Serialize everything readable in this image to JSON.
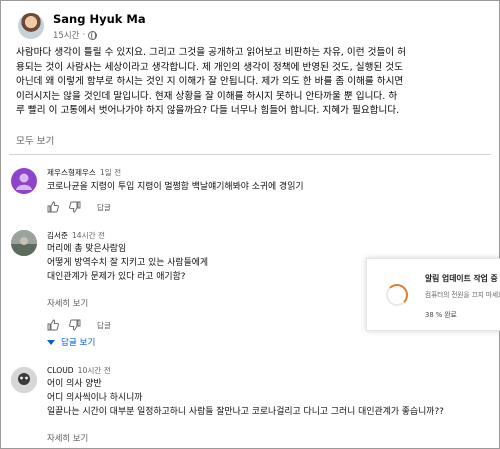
{
  "post": {
    "author": "Sang Hyuk Ma",
    "time": "15시간",
    "audience_icon": "globe-icon",
    "body_lines": [
      "사람마다 생각이 틀릴 수 있지요. 그리고 그것을 공개하고 읽어보고 비판하는 자유, 이런 것들이 허",
      "용되는 것이 사람사는 세상이라고 생각합니다. 제 개인의 생각이 정책에 반영된 것도, 실행된 것도",
      "아닌데 왜 이렇게 함부로 하시는 것인 지 이해가 잘 안됩니다. 제가 의도 한 바를 좀 이해를 하시면",
      "이러시지는 않을 것인데 말입니다. 현재 상황을 잘 이해를 하시지 못하니 안타까울 뿐 입니다. 하",
      "루 빨리 이 고통에서 벗어나가야 하지 않을까요? 다들 너무나 힘들어 합니다. 지혜가 필요합니다."
    ],
    "see_translation": "모두 보기"
  },
  "comments": [
    {
      "author": "제우스형제우스",
      "time": "1일 전",
      "lines": [
        "코로나균을 지령이 투입 지령이 멀쩡함 백날얘기해봐야 소귀에 경읽기"
      ],
      "more": "",
      "reply_label": "답글",
      "avatar_color": "#8e44c8"
    },
    {
      "author": "김서준",
      "time": "14시간 전",
      "lines": [
        "머리에 총 맞은사람임",
        "어떻게 방역수치 잘 지키고 있는 사람들에게",
        "대인관계가 문제가 있다 라고 애기함?"
      ],
      "more": "자세히 보기",
      "reply_label": "답글",
      "replies_toggle": "답글 보기"
    },
    {
      "author": "CLOUD",
      "time": "10시간 전",
      "lines": [
        "어이 의사 양반",
        "어디 의사씩이나 하시니까",
        "일끝나는 시간이 대부분 일정하고하니 사람들 잘만나고 코로나걸리고 다니고 그러니 대인관계가 좋습니까??"
      ],
      "more": "자세히 보기"
    }
  ],
  "toast": {
    "title": "알림 업데이트 작업 중",
    "desc": "컴퓨터의 전원을 끄지 마세요",
    "progress": "38 % 완료",
    "accent": "#e07b2a"
  }
}
